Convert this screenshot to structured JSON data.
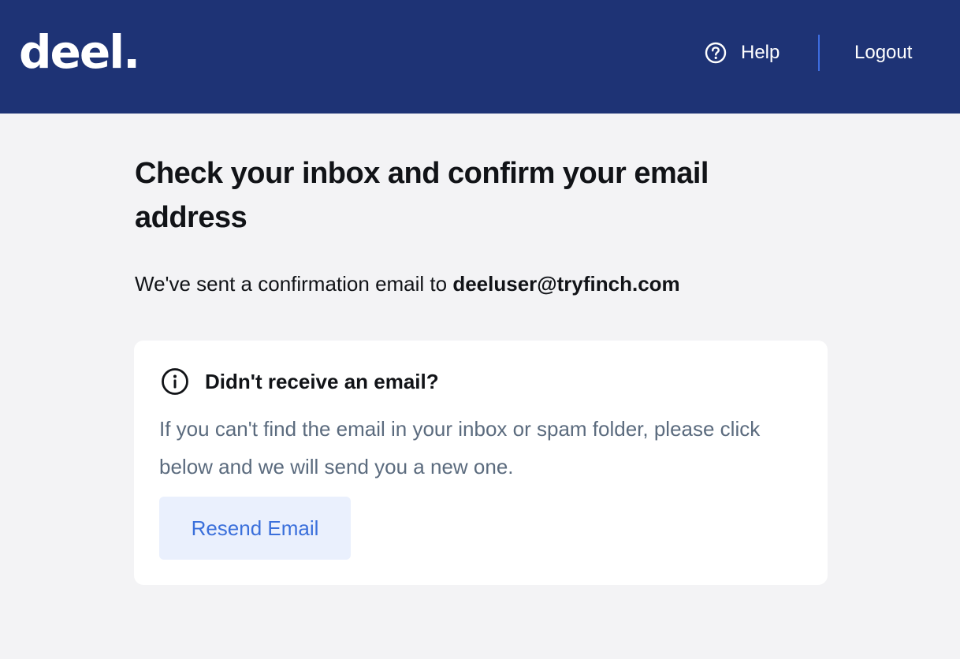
{
  "header": {
    "logo_text": "deel.",
    "help_label": "Help",
    "logout_label": "Logout",
    "background_color": "#1e3375"
  },
  "main": {
    "title": "Check your inbox and confirm your email address",
    "sent_prefix": "We've sent a confirmation email to ",
    "email": "deeluser@tryfinch.com"
  },
  "card": {
    "heading": "Didn't receive an email?",
    "body": "If you can't find the email in your inbox or spam folder, please click below and we will send you a new one.",
    "button_label": "Resend Email",
    "button_color": "#3a6fdb"
  },
  "icons": {
    "help": "question-circle-icon",
    "info": "info-circle-icon"
  }
}
